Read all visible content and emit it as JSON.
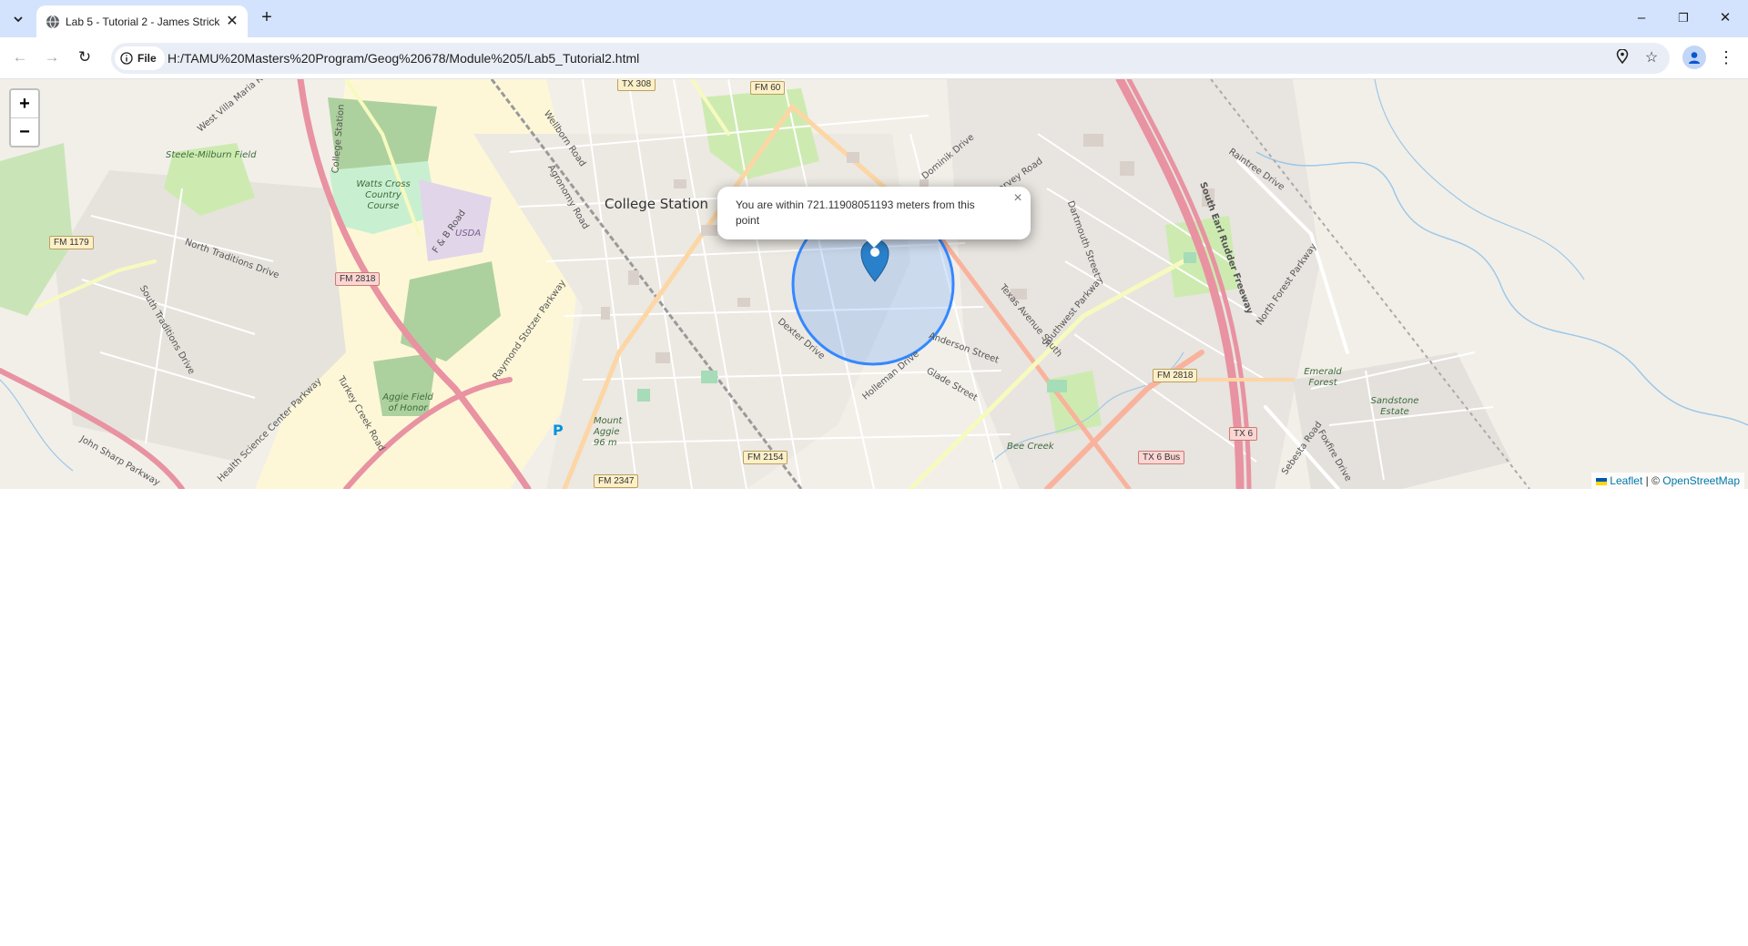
{
  "browser": {
    "tab": {
      "title": "Lab 5 - Tutorial 2 - James Strick",
      "favicon": "globe-icon"
    },
    "new_tab_label": "+",
    "window_controls": {
      "minimize": "–",
      "restore": "❐",
      "close": "✕"
    },
    "address": {
      "scheme_label": "File",
      "url": "H:/TAMU%20Masters%20Program/Geog%20678/Module%205/Lab5_Tutorial2.html"
    },
    "icons": [
      "tab-search-icon",
      "back-icon",
      "forward-icon",
      "reload-icon",
      "info-icon",
      "location-icon",
      "bookmark-star-icon",
      "profile-icon",
      "menu-icon"
    ]
  },
  "map": {
    "zoom_in": "+",
    "zoom_out": "−",
    "city_label": "College Station",
    "popup": {
      "text": "You are within 721.11908051193 meters from this point",
      "close": "×"
    },
    "attribution": {
      "leaflet": "Leaflet",
      "separator": " | © ",
      "osm": "OpenStreetMap"
    },
    "road_labels": [
      "West Villa Maria Road",
      "Wellborn Road",
      "Agronomy Road",
      "F & B Road",
      "North Traditions Drive",
      "South Traditions Drive",
      "Turkey Creek Road",
      "Health Science Center Parkway",
      "John Sharp Parkway",
      "Raymond Stotzer Parkway",
      "Dexter Drive",
      "Holleman Drive",
      "Glade Street",
      "Anderson Street",
      "Texas Avenue South",
      "Southwest Parkway",
      "Dominik Drive",
      "Dartmouth Street",
      "South Earl Rudder Freeway",
      "North Forest Parkway",
      "Raintree Drive",
      "Sebesta Road",
      "Foxfire Drive",
      "College Station",
      "Harvey Road"
    ],
    "area_labels": [
      "Steele-Milburn Field",
      "Watts Cross Country Course",
      "USDA",
      "Aggie Field of Honor",
      "Mount Aggie 96 m",
      "Emerald Forest",
      "Sandstone Estate",
      "Bee Creek"
    ],
    "shields": [
      {
        "label": "TX 308",
        "color": "yellow"
      },
      {
        "label": "FM 60",
        "color": "yellow"
      },
      {
        "label": "FM 1179",
        "color": "yellow"
      },
      {
        "label": "FM 2818",
        "color": "red"
      },
      {
        "label": "FM 2818",
        "color": "yellow"
      },
      {
        "label": "FM 2154",
        "color": "yellow"
      },
      {
        "label": "FM 2347",
        "color": "yellow"
      },
      {
        "label": "TX 6",
        "color": "red"
      },
      {
        "label": "TX 6 Bus",
        "color": "red"
      }
    ],
    "parking_label": "P"
  }
}
